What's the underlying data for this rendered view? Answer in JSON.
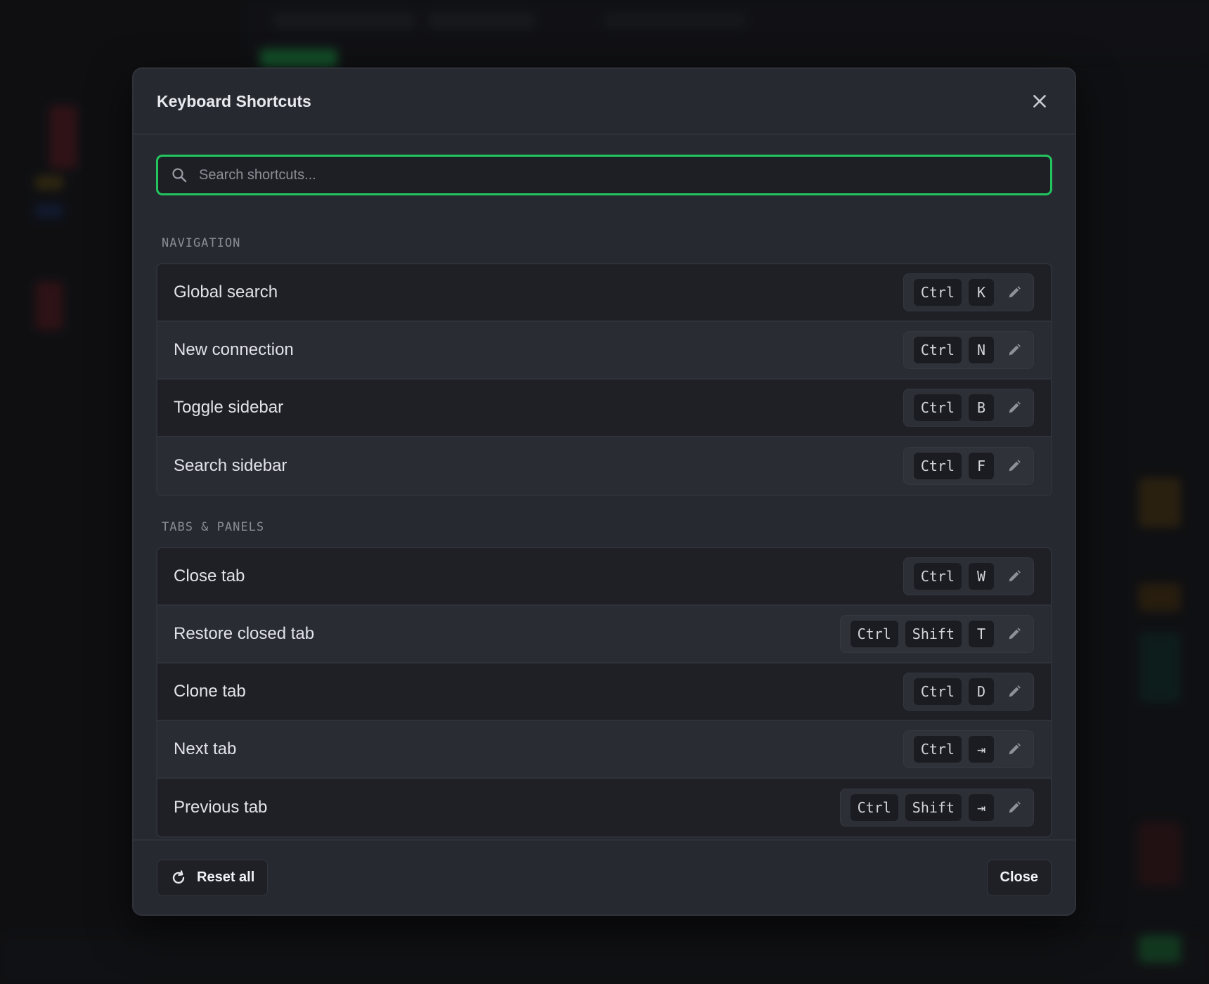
{
  "modal": {
    "title": "Keyboard Shortcuts",
    "search_placeholder": "Search shortcuts...",
    "sections": [
      {
        "title": "NAVIGATION",
        "items": [
          {
            "label": "Global search",
            "keys": [
              "Ctrl",
              "K"
            ]
          },
          {
            "label": "New connection",
            "keys": [
              "Ctrl",
              "N"
            ]
          },
          {
            "label": "Toggle sidebar",
            "keys": [
              "Ctrl",
              "B"
            ]
          },
          {
            "label": "Search sidebar",
            "keys": [
              "Ctrl",
              "F"
            ]
          }
        ]
      },
      {
        "title": "TABS & PANELS",
        "items": [
          {
            "label": "Close tab",
            "keys": [
              "Ctrl",
              "W"
            ]
          },
          {
            "label": "Restore closed tab",
            "keys": [
              "Ctrl",
              "Shift",
              "T"
            ]
          },
          {
            "label": "Clone tab",
            "keys": [
              "Ctrl",
              "D"
            ]
          },
          {
            "label": "Next tab",
            "keys": [
              "Ctrl",
              "⇥"
            ]
          },
          {
            "label": "Previous tab",
            "keys": [
              "Ctrl",
              "Shift",
              "⇥"
            ]
          }
        ]
      }
    ],
    "footer": {
      "reset_label": "Reset all",
      "close_label": "Close"
    }
  },
  "colors": {
    "accent": "#22c55e",
    "modal_bg": "#272931",
    "backdrop": "#15161a"
  },
  "icons": {
    "search": "search-icon",
    "close": "close-icon",
    "edit": "pencil-icon",
    "reset": "refresh-icon"
  }
}
